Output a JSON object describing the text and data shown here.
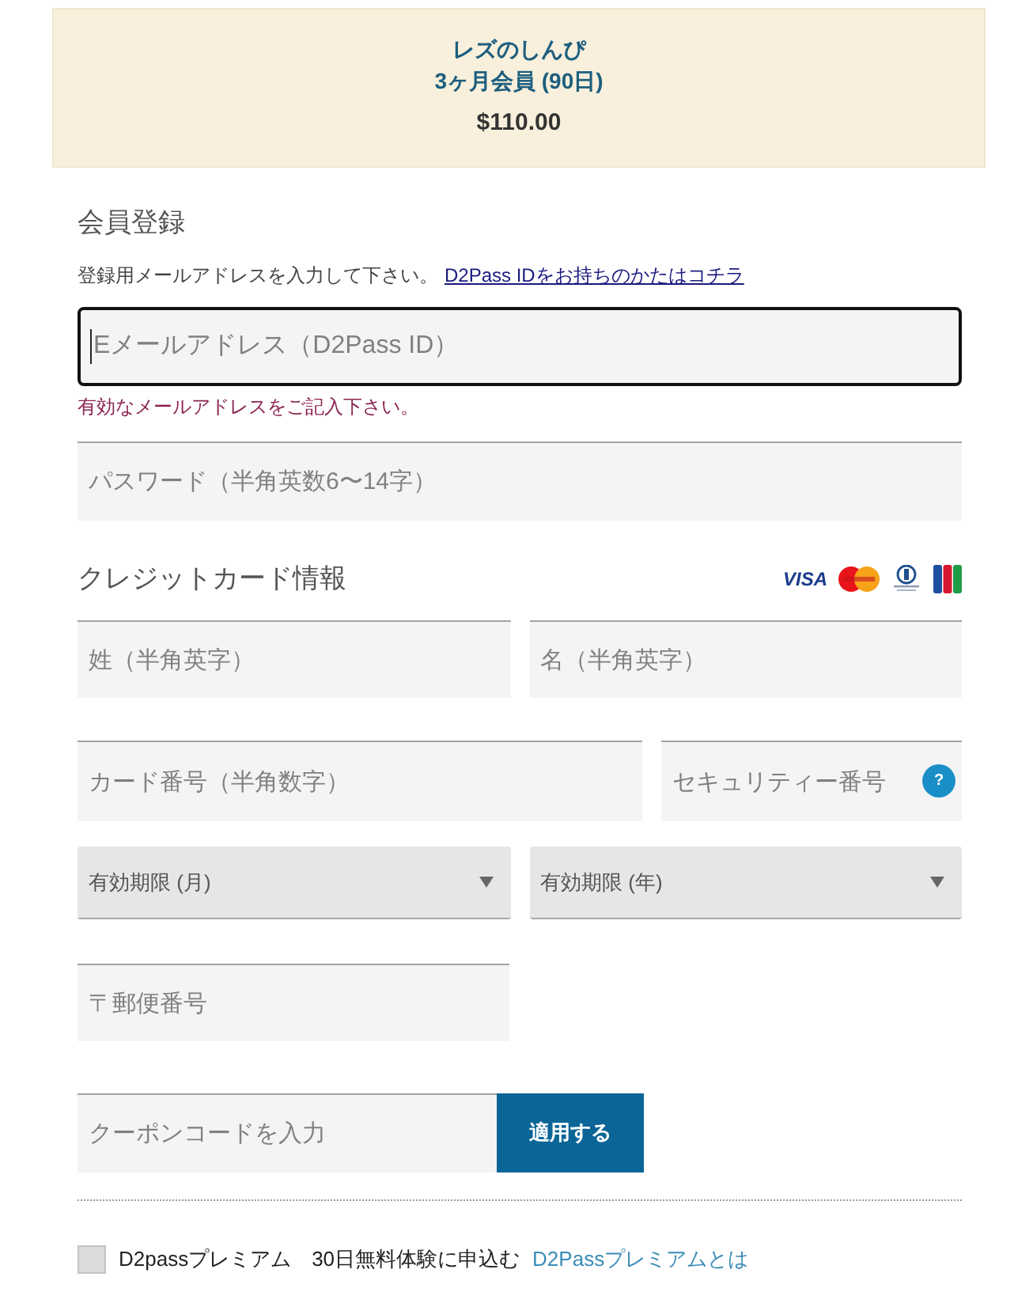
{
  "plan": {
    "name": "レズのしんぴ",
    "term": "3ヶ月会員 (90日)",
    "price": "$110.00"
  },
  "registration": {
    "heading": "会員登録",
    "instruction": "登録用メールアドレスを入力して下さい。",
    "login_link": "D2Pass IDをお持ちのかたはコチラ",
    "email": {
      "placeholder": "Eメールアドレス（D2Pass ID）",
      "focused": true,
      "error": "有効なメールアドレスをご記入下さい。"
    },
    "password": {
      "placeholder": "パスワード（半角英数6〜14字）"
    }
  },
  "credit_card": {
    "heading": "クレジットカード情報",
    "logos": [
      {
        "kind": "wordmark",
        "text": "VISA"
      },
      {
        "kind": "circles"
      },
      {
        "kind": "emblem"
      },
      {
        "kind": "stripes"
      }
    ],
    "name_fields": [
      {
        "placeholder": "姓（半角英字）"
      },
      {
        "placeholder": "名（半角英字）"
      }
    ],
    "card_number": {
      "placeholder": "カード番号（半角数字）"
    },
    "security_code": {
      "placeholder": "セキュリティー番号",
      "help": "?"
    },
    "expiry_selects": [
      {
        "label": "有効期限 (月)"
      },
      {
        "label": "有効期限 (年)"
      }
    ],
    "postal_code": {
      "placeholder": "〒郵便番号"
    }
  },
  "coupon": {
    "placeholder": "クーポンコードを入力",
    "button": "適用する"
  },
  "premium": {
    "checked": false,
    "label": "D2passプレミアム　30日無料体験に申込む",
    "link": "D2Passプレミアムとは"
  }
}
